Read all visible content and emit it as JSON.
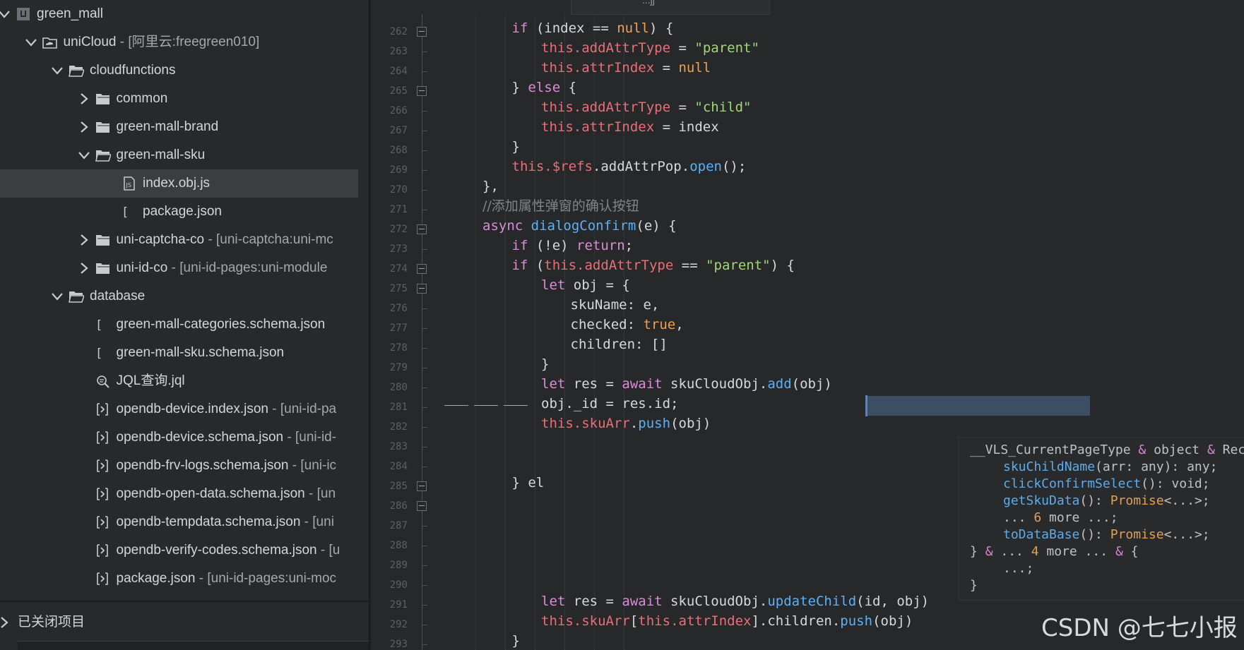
{
  "sidebar": {
    "tree": [
      {
        "label": "green_mall",
        "suffix": "",
        "icon": "project-icon",
        "chevron": "expanded"
      },
      {
        "label": "uniCloud",
        "suffix": " - [阿里云:freegreen010]",
        "icon": "cloud-folder-icon",
        "chevron": "expanded"
      },
      {
        "label": "cloudfunctions",
        "suffix": "",
        "icon": "folder-open-icon",
        "chevron": "expanded"
      },
      {
        "label": "common",
        "suffix": "",
        "icon": "folder-icon",
        "chevron": "collapsed"
      },
      {
        "label": "green-mall-brand",
        "suffix": "",
        "icon": "folder-icon",
        "chevron": "collapsed"
      },
      {
        "label": "green-mall-sku",
        "suffix": "",
        "icon": "folder-open-icon",
        "chevron": "expanded"
      },
      {
        "label": "index.obj.js",
        "suffix": "",
        "icon": "js-file-icon",
        "chevron": "none",
        "selected": true
      },
      {
        "label": "package.json",
        "suffix": "",
        "icon": "json-file-icon",
        "chevron": "none"
      },
      {
        "label": "uni-captcha-co",
        "suffix": " - [uni-captcha:uni-mc",
        "icon": "folder-icon",
        "chevron": "collapsed"
      },
      {
        "label": "uni-id-co",
        "suffix": " - [uni-id-pages:uni-module",
        "icon": "folder-icon",
        "chevron": "collapsed"
      },
      {
        "label": "database",
        "suffix": "",
        "icon": "folder-open-icon",
        "chevron": "expanded"
      },
      {
        "label": "green-mall-categories.schema.json",
        "suffix": "",
        "icon": "json-file-icon",
        "chevron": "none"
      },
      {
        "label": "green-mall-sku.schema.json",
        "suffix": "",
        "icon": "json-file-icon",
        "chevron": "none"
      },
      {
        "label": "JQL查询.jql",
        "suffix": "",
        "icon": "jql-file-icon",
        "chevron": "none"
      },
      {
        "label": "opendb-device.index.json",
        "suffix": " - [uni-id-pa",
        "icon": "schema-file-icon",
        "chevron": "none"
      },
      {
        "label": "opendb-device.schema.json",
        "suffix": " - [uni-id-",
        "icon": "schema-file-icon",
        "chevron": "none"
      },
      {
        "label": "opendb-frv-logs.schema.json",
        "suffix": " - [uni-ic",
        "icon": "schema-file-icon",
        "chevron": "none"
      },
      {
        "label": "opendb-open-data.schema.json",
        "suffix": " - [un",
        "icon": "schema-file-icon",
        "chevron": "none"
      },
      {
        "label": "opendb-tempdata.schema.json",
        "suffix": " - [uni",
        "icon": "schema-file-icon",
        "chevron": "none"
      },
      {
        "label": "opendb-verify-codes.schema.json",
        "suffix": " - [u",
        "icon": "schema-file-icon",
        "chevron": "none"
      },
      {
        "label": "package.json",
        "suffix": " - [uni-id-pages:uni-moc",
        "icon": "schema-file-icon",
        "chevron": "none"
      }
    ],
    "closed_projects_label": "已关闭项目"
  },
  "editor": {
    "tab_partial_text": "...jj",
    "line_numbers": [
      "262",
      "263",
      "264",
      "265",
      "266",
      "267",
      "268",
      "269",
      "270",
      "271",
      "272",
      "273",
      "274",
      "275",
      "276",
      "277",
      "278",
      "279",
      "280",
      "281",
      "282",
      "283",
      "284",
      "285",
      "286",
      "287",
      "288",
      "289",
      "290",
      "291",
      "292",
      "293"
    ],
    "code_lines": [
      "if (index == null) {",
      "this.addAttrType = \"parent\"",
      "this.attrIndex = null",
      "} else {",
      "this.addAttrType = \"child\"",
      "this.attrIndex = index",
      "}",
      "this.$refs.addAttrPop.open();",
      "},",
      "//添加属性弹窗的确认按钮",
      "async dialogConfirm(e) {",
      "if (!e) return;",
      "if (this.addAttrType == \"parent\") {",
      "let obj = {",
      "skuName: e,",
      "checked: true,",
      "children: []",
      "}",
      "let res = await skuCloudObj.add(obj)",
      "obj._id = res.id;",
      "this.skuArr.push(obj)",
      "",
      "",
      "} el",
      "",
      "",
      "",
      "",
      "",
      "let res = await skuCloudObj.updateChild(id, obj)",
      "this.skuArr[this.attrIndex].children.push(obj)",
      "}"
    ]
  },
  "tooltip": {
    "lines": [
      "__VLS_CurrentPageType & object & Record<never, any> & Vue & {",
      "skuChildName(arr: any): any;",
      "clickConfirmSelect(): void;",
      "getSkuData(): Promise<...>;",
      "... 6 more ...;",
      "toDataBase(): Promise<...>;",
      "} & ... 4 more ... & {",
      "...;",
      "}"
    ]
  },
  "watermark": "CSDN @七七小报",
  "colors": {
    "keyword": "#d88ed6",
    "this_prop": "#e6707a",
    "string": "#a3d57a",
    "function": "#5eb0f3",
    "literal": "#e8a25a",
    "comment": "#808488",
    "selection": "#3d4e64"
  }
}
